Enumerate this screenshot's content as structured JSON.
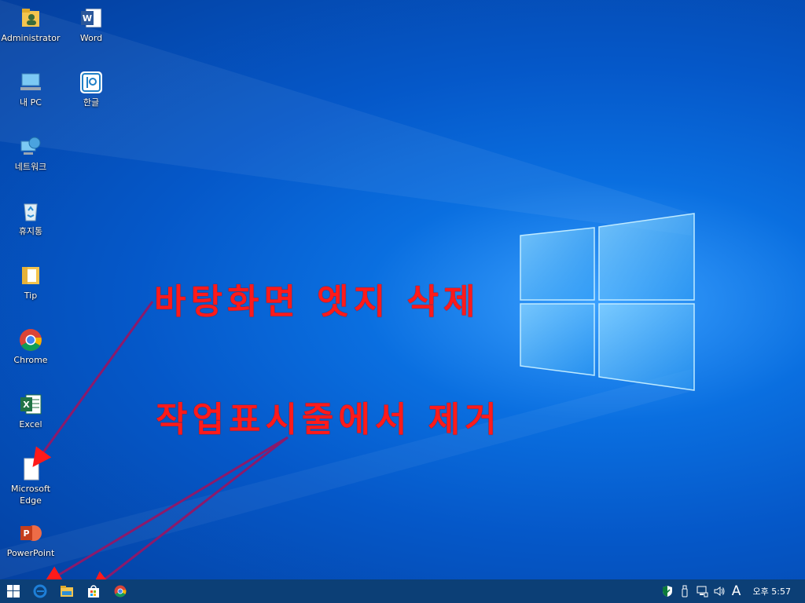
{
  "desktop": {
    "icons": [
      {
        "label": "Administrator",
        "icon": "user-folder-icon"
      },
      {
        "label": "Word",
        "icon": "word-icon"
      },
      {
        "label": "내 PC",
        "icon": "computer-icon"
      },
      {
        "label": "한글",
        "icon": "hangul-icon"
      },
      {
        "label": "네트워크",
        "icon": "network-icon"
      },
      {
        "label": "휴지통",
        "icon": "recycle-bin-icon"
      },
      {
        "label": "Tip",
        "icon": "folder-icon"
      },
      {
        "label": "Chrome",
        "icon": "chrome-icon"
      },
      {
        "label": "Excel",
        "icon": "excel-icon"
      },
      {
        "label": "Microsoft Edge",
        "icon": "blank-file-icon"
      },
      {
        "label": "PowerPoint",
        "icon": "powerpoint-icon"
      }
    ]
  },
  "annotations": {
    "top": "바탕화면 엣지 삭제",
    "bottom": "작업표시줄에서 제거"
  },
  "taskbar": {
    "pinned": [
      "start-icon",
      "edge-icon",
      "file-explorer-icon",
      "store-icon",
      "chrome-icon"
    ],
    "tray": {
      "ime": "A",
      "clock": "오후 5:57"
    }
  },
  "colors": {
    "annotation": "#ff1a1a",
    "arrow": "#8b1a6b",
    "taskbar": "#0c3f76",
    "desktop": "#0558c9"
  }
}
